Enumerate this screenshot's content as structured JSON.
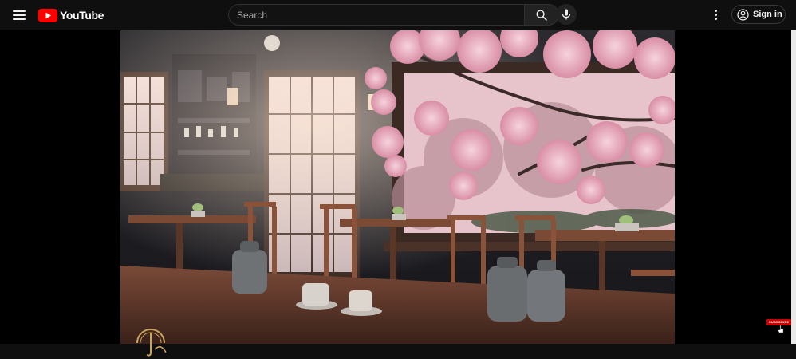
{
  "header": {
    "logo_text": "YouTube",
    "search": {
      "placeholder": "Search",
      "value": ""
    },
    "signin_label": "Sign in"
  },
  "icons": {
    "menu": "hamburger-menu-icon",
    "logo": "youtube-play-icon",
    "search": "search-icon",
    "mic": "microphone-icon",
    "more": "vertical-dots-icon",
    "account": "account-circle-icon"
  },
  "player": {
    "watermark_badge": "SUBSCRIBE"
  },
  "colors": {
    "background": "#0f0f0f",
    "brand_red": "#ff0000",
    "subscribe_red": "#cc0000",
    "text": "#f1f1f1"
  }
}
